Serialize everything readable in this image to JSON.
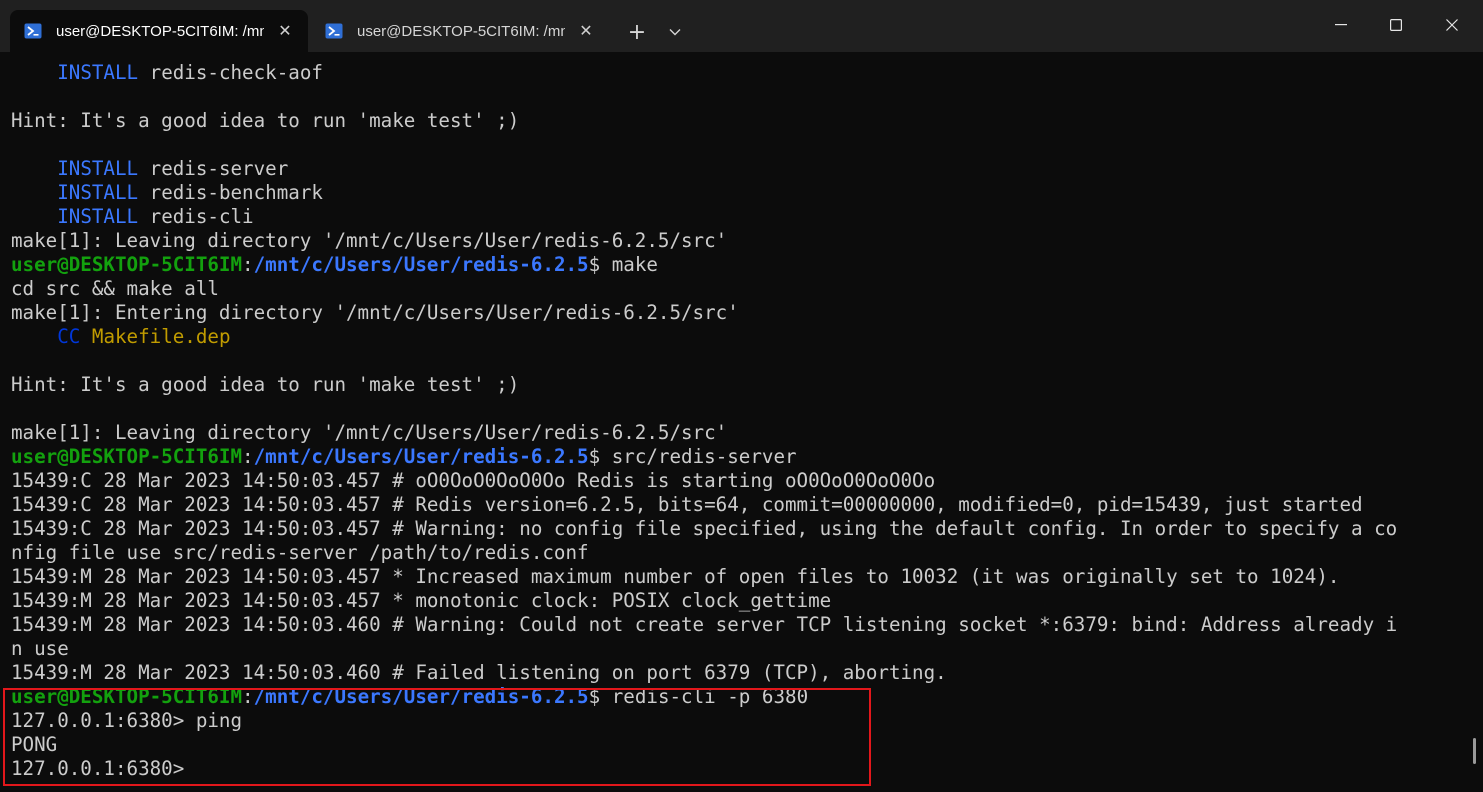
{
  "tabs": [
    {
      "title": "user@DESKTOP-5CIT6IM: /mn",
      "active": true
    },
    {
      "title": "user@DESKTOP-5CIT6IM: /mn",
      "active": false
    }
  ],
  "tab_close_glyph": "✕",
  "new_tab_glyph": "+",
  "icons": {
    "tab": "powershell-terminal-icon",
    "dropdown": "chevron-down-icon",
    "minimize": "minimize-icon",
    "maximize": "maximize-icon",
    "close": "close-icon"
  },
  "colors": {
    "prompt_user": "#13a10e",
    "prompt_path": "#3b78ff",
    "install_keyword": "#3b78ff",
    "cc_keyword": "#0037da",
    "filename": "#c19c00",
    "highlight_border": "#e3171b"
  },
  "prompt": {
    "user": "user@DESKTOP-5CIT6IM",
    "path": "/mnt/c/Users/User/redis-6.2.5",
    "symbol": "$ "
  },
  "lines": [
    {
      "segments": [
        {
          "text": "    "
        },
        {
          "text": "INSTALL",
          "style": "kw"
        },
        {
          "text": " redis-check-aof"
        }
      ]
    },
    {
      "segments": [
        {
          "text": ""
        }
      ]
    },
    {
      "segments": [
        {
          "text": "Hint: It's a good idea to run 'make test' ;)"
        }
      ]
    },
    {
      "segments": [
        {
          "text": ""
        }
      ]
    },
    {
      "segments": [
        {
          "text": "    "
        },
        {
          "text": "INSTALL",
          "style": "kw"
        },
        {
          "text": " redis-server"
        }
      ]
    },
    {
      "segments": [
        {
          "text": "    "
        },
        {
          "text": "INSTALL",
          "style": "kw"
        },
        {
          "text": " redis-benchmark"
        }
      ]
    },
    {
      "segments": [
        {
          "text": "    "
        },
        {
          "text": "INSTALL",
          "style": "kw"
        },
        {
          "text": " redis-cli"
        }
      ]
    },
    {
      "segments": [
        {
          "text": "make[1]: Leaving directory '/mnt/c/Users/User/redis-6.2.5/src'"
        }
      ]
    },
    {
      "prompt": true,
      "command": "make"
    },
    {
      "segments": [
        {
          "text": "cd src && make all"
        }
      ]
    },
    {
      "segments": [
        {
          "text": "make[1]: Entering directory '/mnt/c/Users/User/redis-6.2.5/src'"
        }
      ]
    },
    {
      "segments": [
        {
          "text": "    "
        },
        {
          "text": "CC",
          "style": "cc"
        },
        {
          "text": " "
        },
        {
          "text": "Makefile.dep",
          "style": "yellow"
        }
      ]
    },
    {
      "segments": [
        {
          "text": ""
        }
      ]
    },
    {
      "segments": [
        {
          "text": "Hint: It's a good idea to run 'make test' ;)"
        }
      ]
    },
    {
      "segments": [
        {
          "text": ""
        }
      ]
    },
    {
      "segments": [
        {
          "text": "make[1]: Leaving directory '/mnt/c/Users/User/redis-6.2.5/src'"
        }
      ]
    },
    {
      "prompt": true,
      "command": "src/redis-server"
    },
    {
      "segments": [
        {
          "text": "15439:C 28 Mar 2023 14:50:03.457 # oO0OoO0OoO0Oo Redis is starting oO0OoO0OoO0Oo"
        }
      ]
    },
    {
      "segments": [
        {
          "text": "15439:C 28 Mar 2023 14:50:03.457 # Redis version=6.2.5, bits=64, commit=00000000, modified=0, pid=15439, just started"
        }
      ]
    },
    {
      "segments": [
        {
          "text": "15439:C 28 Mar 2023 14:50:03.457 # Warning: no config file specified, using the default config. In order to specify a co"
        }
      ]
    },
    {
      "segments": [
        {
          "text": "nfig file use src/redis-server /path/to/redis.conf"
        }
      ]
    },
    {
      "segments": [
        {
          "text": "15439:M 28 Mar 2023 14:50:03.457 * Increased maximum number of open files to 10032 (it was originally set to 1024)."
        }
      ]
    },
    {
      "segments": [
        {
          "text": "15439:M 28 Mar 2023 14:50:03.457 * monotonic clock: POSIX clock_gettime"
        }
      ]
    },
    {
      "segments": [
        {
          "text": "15439:M 28 Mar 2023 14:50:03.460 # Warning: Could not create server TCP listening socket *:6379: bind: Address already i"
        }
      ]
    },
    {
      "segments": [
        {
          "text": "n use"
        }
      ]
    },
    {
      "segments": [
        {
          "text": "15439:M 28 Mar 2023 14:50:03.460 # Failed listening on port 6379 (TCP), aborting."
        }
      ]
    },
    {
      "prompt": true,
      "command": "redis-cli -p 6380"
    },
    {
      "segments": [
        {
          "text": "127.0.0.1:6380> ping"
        }
      ]
    },
    {
      "segments": [
        {
          "text": "PONG"
        }
      ]
    },
    {
      "segments": [
        {
          "text": "127.0.0.1:6380> "
        }
      ]
    }
  ]
}
